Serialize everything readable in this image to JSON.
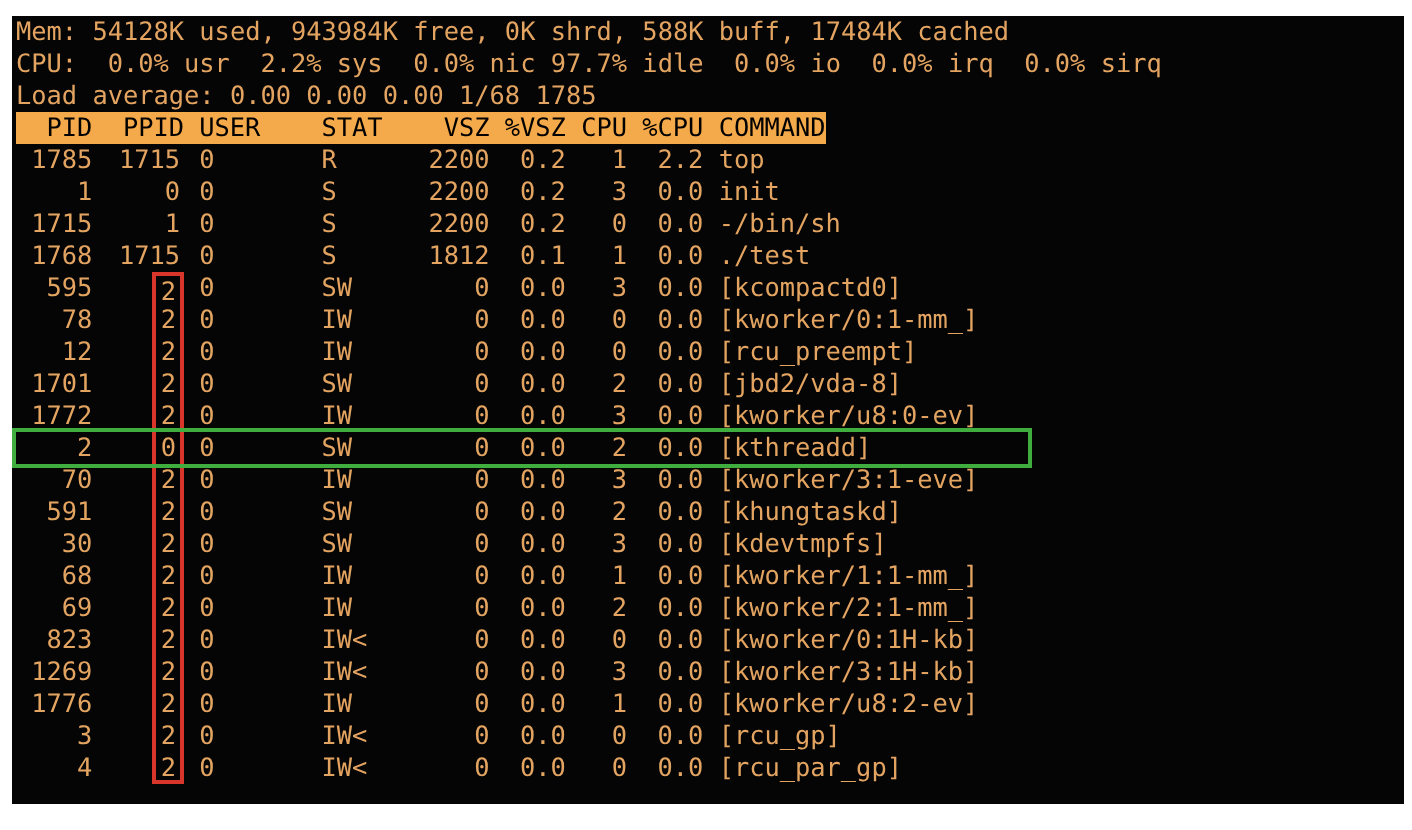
{
  "summary_lines": [
    "Mem: 54128K used, 943984K free, 0K shrd, 588K buff, 17484K cached",
    "CPU:  0.0% usr  2.2% sys  0.0% nic 97.7% idle  0.0% io  0.0% irq  0.0% sirq",
    "Load average: 0.00 0.00 0.00 1/68 1785"
  ],
  "table": {
    "columns": [
      "PID",
      "PPID",
      "USER",
      "STAT",
      "VSZ",
      "%VSZ",
      "CPU",
      "%CPU",
      "COMMAND"
    ],
    "rows": [
      {
        "cells": [
          "1785",
          "1715",
          "0",
          "R",
          "2200",
          "0.2",
          "1",
          "2.2",
          "top"
        ],
        "ppid_marked": false,
        "selected": false
      },
      {
        "cells": [
          "1",
          "0",
          "0",
          "S",
          "2200",
          "0.2",
          "3",
          "0.0",
          "init"
        ],
        "ppid_marked": false,
        "selected": false
      },
      {
        "cells": [
          "1715",
          "1",
          "0",
          "S",
          "2200",
          "0.2",
          "0",
          "0.0",
          "-/bin/sh"
        ],
        "ppid_marked": false,
        "selected": false
      },
      {
        "cells": [
          "1768",
          "1715",
          "0",
          "S",
          "1812",
          "0.1",
          "1",
          "0.0",
          "./test"
        ],
        "ppid_marked": false,
        "selected": false
      },
      {
        "cells": [
          "595",
          "2",
          "0",
          "SW",
          "0",
          "0.0",
          "3",
          "0.0",
          "[kcompactd0]"
        ],
        "ppid_marked": true,
        "selected": false
      },
      {
        "cells": [
          "78",
          "2",
          "0",
          "IW",
          "0",
          "0.0",
          "0",
          "0.0",
          "[kworker/0:1-mm_]"
        ],
        "ppid_marked": true,
        "selected": false
      },
      {
        "cells": [
          "12",
          "2",
          "0",
          "IW",
          "0",
          "0.0",
          "0",
          "0.0",
          "[rcu_preempt]"
        ],
        "ppid_marked": true,
        "selected": false
      },
      {
        "cells": [
          "1701",
          "2",
          "0",
          "SW",
          "0",
          "0.0",
          "2",
          "0.0",
          "[jbd2/vda-8]"
        ],
        "ppid_marked": true,
        "selected": false
      },
      {
        "cells": [
          "1772",
          "2",
          "0",
          "IW",
          "0",
          "0.0",
          "3",
          "0.0",
          "[kworker/u8:0-ev]"
        ],
        "ppid_marked": true,
        "selected": false
      },
      {
        "cells": [
          "2",
          "0",
          "0",
          "SW",
          "0",
          "0.0",
          "2",
          "0.0",
          "[kthreadd]"
        ],
        "ppid_marked": true,
        "selected": true
      },
      {
        "cells": [
          "70",
          "2",
          "0",
          "IW",
          "0",
          "0.0",
          "3",
          "0.0",
          "[kworker/3:1-eve]"
        ],
        "ppid_marked": true,
        "selected": false
      },
      {
        "cells": [
          "591",
          "2",
          "0",
          "SW",
          "0",
          "0.0",
          "2",
          "0.0",
          "[khungtaskd]"
        ],
        "ppid_marked": true,
        "selected": false
      },
      {
        "cells": [
          "30",
          "2",
          "0",
          "SW",
          "0",
          "0.0",
          "3",
          "0.0",
          "[kdevtmpfs]"
        ],
        "ppid_marked": true,
        "selected": false
      },
      {
        "cells": [
          "68",
          "2",
          "0",
          "IW",
          "0",
          "0.0",
          "1",
          "0.0",
          "[kworker/1:1-mm_]"
        ],
        "ppid_marked": true,
        "selected": false
      },
      {
        "cells": [
          "69",
          "2",
          "0",
          "IW",
          "0",
          "0.0",
          "2",
          "0.0",
          "[kworker/2:1-mm_]"
        ],
        "ppid_marked": true,
        "selected": false
      },
      {
        "cells": [
          "823",
          "2",
          "0",
          "IW<",
          "0",
          "0.0",
          "0",
          "0.0",
          "[kworker/0:1H-kb]"
        ],
        "ppid_marked": true,
        "selected": false
      },
      {
        "cells": [
          "1269",
          "2",
          "0",
          "IW<",
          "0",
          "0.0",
          "3",
          "0.0",
          "[kworker/3:1H-kb]"
        ],
        "ppid_marked": true,
        "selected": false
      },
      {
        "cells": [
          "1776",
          "2",
          "0",
          "IW",
          "0",
          "0.0",
          "1",
          "0.0",
          "[kworker/u8:2-ev]"
        ],
        "ppid_marked": true,
        "selected": false
      },
      {
        "cells": [
          "3",
          "2",
          "0",
          "IW<",
          "0",
          "0.0",
          "0",
          "0.0",
          "[rcu_gp]"
        ],
        "ppid_marked": true,
        "selected": false
      },
      {
        "cells": [
          "4",
          "2",
          "0",
          "IW<",
          "0",
          "0.0",
          "0",
          "0.0",
          "[rcu_par_gp]"
        ],
        "ppid_marked": true,
        "selected": false
      }
    ]
  }
}
